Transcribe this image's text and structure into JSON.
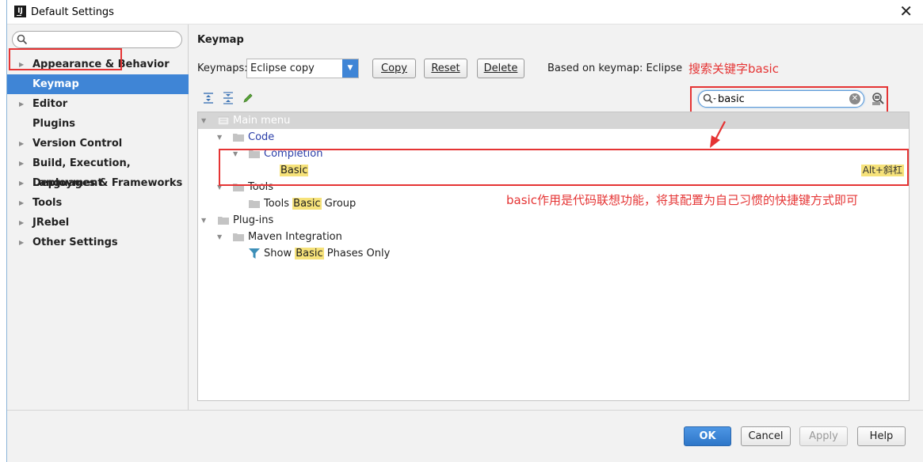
{
  "window": {
    "title": "Default Settings"
  },
  "sidebar": {
    "search_value": "",
    "items": [
      {
        "label": "Appearance & Behavior",
        "expandable": true
      },
      {
        "label": "Keymap",
        "expandable": false,
        "selected": true
      },
      {
        "label": "Editor",
        "expandable": true
      },
      {
        "label": "Plugins",
        "expandable": false
      },
      {
        "label": "Version Control",
        "expandable": true
      },
      {
        "label": "Build, Execution, Deployment",
        "expandable": true
      },
      {
        "label": "Languages & Frameworks",
        "expandable": true
      },
      {
        "label": "Tools",
        "expandable": true
      },
      {
        "label": "JRebel",
        "expandable": true
      },
      {
        "label": "Other Settings",
        "expandable": true
      }
    ]
  },
  "keymap": {
    "title": "Keymap",
    "keymaps_label": "Keymaps:",
    "selected_keymap": "Eclipse copy",
    "buttons": {
      "copy": "Copy",
      "reset": "Reset",
      "delete": "Delete"
    },
    "based_on": "Based on keymap: Eclipse",
    "search_value": "basic"
  },
  "annotations": {
    "search_note": "搜索关键字basic",
    "usage_note": "basic作用是代码联想功能，将其配置为自己习惯的快捷键方式即可"
  },
  "tree": {
    "main_menu": "Main menu",
    "code": "Code",
    "completion": "Completion",
    "basic": "Basic",
    "basic_shortcut": "Alt+斜杠",
    "tools": "Tools",
    "tools_group_pre": "Tools ",
    "tools_group_hl": "Basic",
    "tools_group_post": " Group",
    "plugins": "Plug-ins",
    "maven": "Maven Integration",
    "show_pre": "Show ",
    "show_hl": "Basic",
    "show_post": " Phases Only"
  },
  "footer": {
    "ok": "OK",
    "cancel": "Cancel",
    "apply": "Apply",
    "help": "Help"
  },
  "colors": {
    "accent": "#3f85d6",
    "annotation": "#e53434",
    "highlight": "#f6e27a"
  }
}
